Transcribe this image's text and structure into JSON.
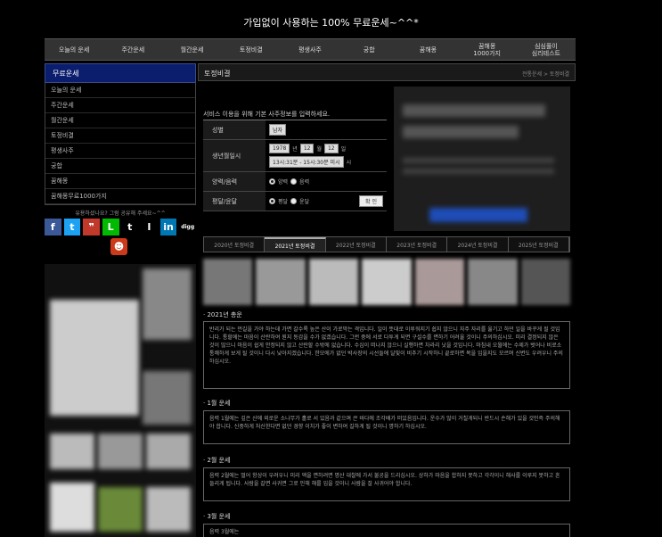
{
  "site": {
    "title": "가입없이 사용하는 100% 무료운세~^^*"
  },
  "topnav": [
    "오늘의 운세",
    "주간운세",
    "월간운세",
    "토정비결",
    "평생사주",
    "궁합",
    "꿈해몽",
    "꿈해몽\n1000가지",
    "심심풀이\n심리테스트"
  ],
  "sidebar": {
    "header": "무료운세",
    "items": [
      "오늘의 운세",
      "주간운세",
      "월간운세",
      "토정비결",
      "평생사주",
      "궁합",
      "꿈해몽",
      "꿈해몽무료1000가지"
    ],
    "share_text": "유용하셨나요? 그럼 공유해 주세요~^^",
    "share_buttons": [
      {
        "icon": "facebook-icon",
        "glyph": "f",
        "color": "#3b5998"
      },
      {
        "icon": "twitter-icon",
        "glyph": "t",
        "color": "#1da1f2"
      },
      {
        "icon": "quote-icon",
        "glyph": "❞",
        "color": "#c0392b"
      },
      {
        "icon": "line-icon",
        "glyph": "L",
        "color": "#00b900"
      },
      {
        "icon": "tumblr-icon",
        "glyph": "t",
        "color": "#000"
      },
      {
        "icon": "bar-icon",
        "glyph": "I",
        "color": "#000"
      },
      {
        "icon": "linkedin-icon",
        "glyph": "in",
        "color": "#0077b5"
      },
      {
        "icon": "digg-icon",
        "glyph": "digg",
        "color": "#000"
      }
    ],
    "reddit_icon": "reddit-icon"
  },
  "main": {
    "title": "토정비결",
    "breadcrumb": "전통운세 > 토정비결",
    "intro": "서비스 이용을 위해 기본 사주정보를 입력하세요.",
    "form": {
      "gender_label": "성별",
      "gender_value": "남자",
      "birth_label": "생년월일시",
      "year": "1978",
      "year_unit": "년",
      "month": "12",
      "month_unit": "월",
      "day": "12",
      "day_unit": "일",
      "time": "13시:31분 - 15시:30분 미시",
      "time_unit": "시",
      "calendar_label": "양력/음력",
      "solar": "양력",
      "lunar": "음력",
      "leap_label": "평달/윤달",
      "normal_month": "평달",
      "leap_month": "윤달",
      "check_button": "확 인"
    },
    "year_tabs": [
      "2020년 토정비결",
      "2021년 토정비결",
      "2022년 토정비결",
      "2023년 토정비결",
      "2024년 토정비결",
      "2025년 토정비결"
    ],
    "active_tab": 1,
    "sections": [
      {
        "title": "· 2021년 총운",
        "body": "반리가 되는 먼길을 가야 하는데 가면 갈수록 높은 산이 가로막는 격입니다. 일이 뜻대로 이루워지기 쉽지 않으니 자주 자리를 옮기고 하던 일을 바꾸게 될 것입니다. 통할에는 마음이 산란하여 뭔지 동감을 수가 없겠습니다. 그런 중에 서로 다투게 되면 구설수를 면하기 어려울 것이니 주의하십시오. 미리 결정되지 않은 것이 많으니 마음이 쉽게 안정되지 않고 산란할 수밖에 없습니다. 수심이 떠나지 않으니 실행하면 차라리 낫을 것입니다. 마침내 오월에는 수제가 벗어나 비로소 통쾌하게 보게 될 것이니 다시 낮아지겠습니다. 한모에가 없던 박사장의 시선들에 달빛이 비추기 시작하니 끝로하면 복을 입을지도 모르며 신변도 우려우니 주의하십시오."
      },
      {
        "title": "· 1월 운세",
        "body": "음력 1월에는 깊은 산에 외로운 소나무가 홀로 서 있음과 같으며 큰 바다에 조각배가 떠있음입니다. 운수가 많이 거칠게되니 반드시 손해가 있을 것인즉 주의해야 합니다. 신중하게 처신한다면 없던 경향 이치가 좋이 변하여 길하게 될 것이니 명하기 하십시오."
      },
      {
        "title": "· 2월 운세",
        "body": "음력 2월에는 멀어 항상이 우려우니 미리 액을 면하려면 명산 대찰에 가서 불공을 드리십시오. 상하가 마음을 합하지 못하고 각각이니 해사를 이루지 못하고 흔들리게 됩니다. 사람을 갈면 사귀면 그로 인해 해를 입을 것이니 사람을 잘 사귀어야 합니다."
      },
      {
        "title": "· 3월 운세",
        "body": "음력 3월에는"
      }
    ]
  }
}
